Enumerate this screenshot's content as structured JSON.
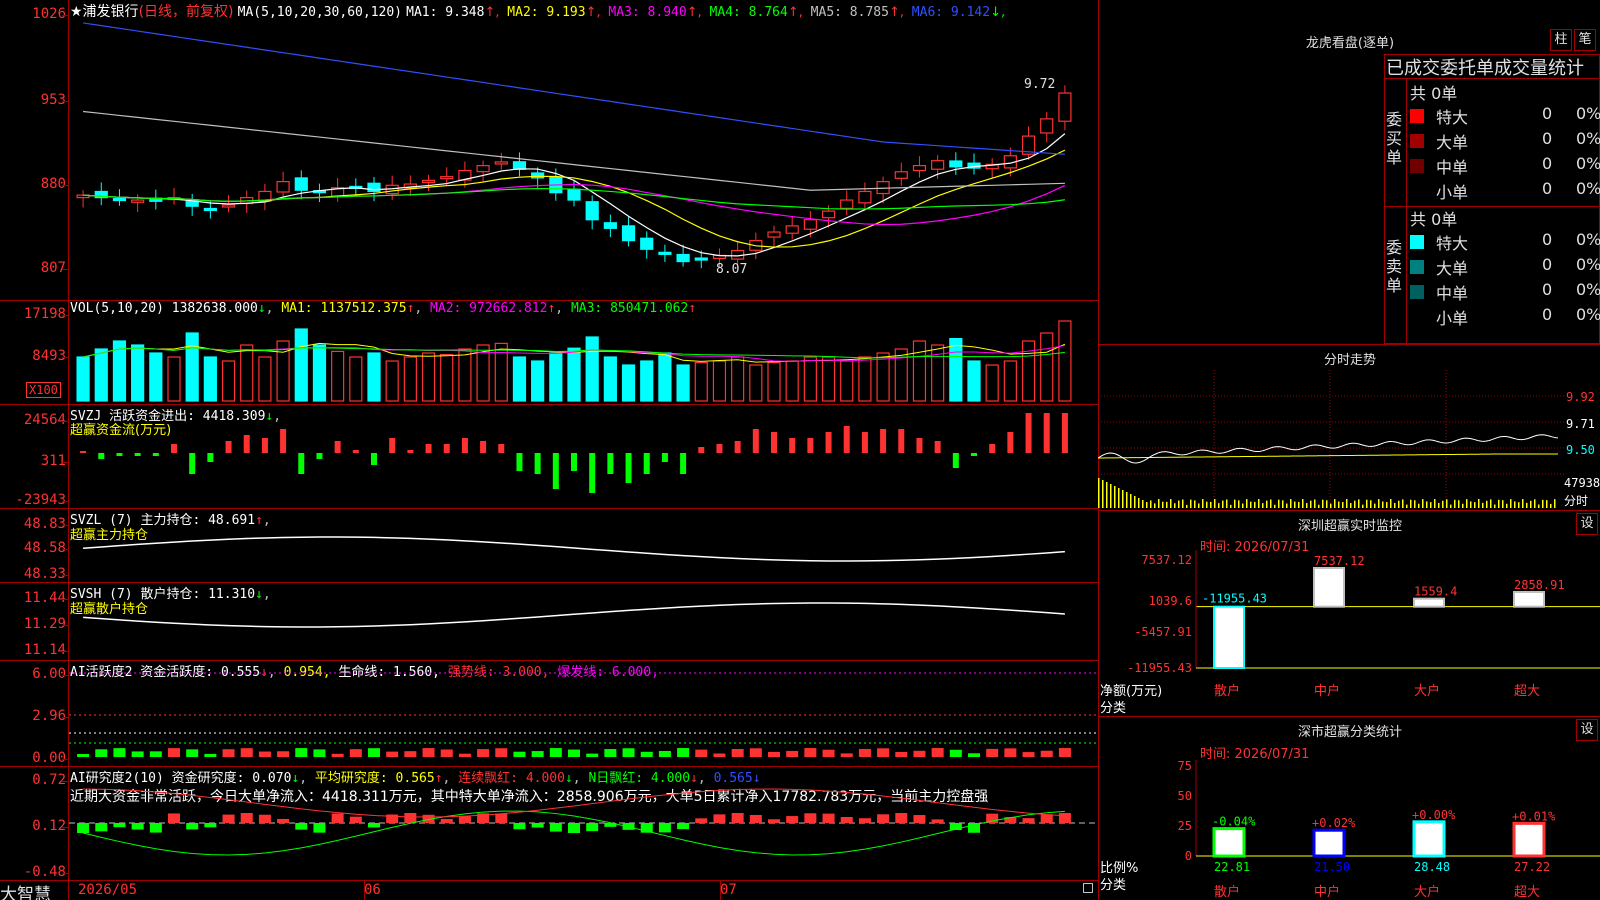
{
  "main": {
    "title": "★浦发银行",
    "period": "(日线，前复权)",
    "ma_header": "MA(5,10,20,30,60,120)",
    "ma": [
      {
        "label": "MA1:",
        "value": "9.348",
        "color": "#ffffff"
      },
      {
        "label": "MA2:",
        "value": "9.193",
        "color": "#ffff00"
      },
      {
        "label": "MA3:",
        "value": "8.940",
        "color": "#ff00ff"
      },
      {
        "label": "MA4:",
        "value": "8.764",
        "color": "#00ff00"
      },
      {
        "label": "MA5:",
        "value": "8.785",
        "color": "#c0c0c0"
      },
      {
        "label": "MA6:",
        "value": "9.142",
        "color": "#3050ff"
      }
    ],
    "y_ticks": [
      "1026",
      "953",
      "880",
      "807"
    ],
    "high_label": "9.72",
    "low_label": "8.07"
  },
  "vol": {
    "header": "VOL(5,10,20)",
    "value": "1382638.000",
    "ma1": "MA1: 1137512.375",
    "ma2": "MA2: 972662.812",
    "ma3": "MA3: 850471.062",
    "y_ticks": [
      "17198",
      "8493"
    ],
    "unit": "X100"
  },
  "svzj": {
    "header": "SVZJ  活跃资金进出: 4418.309",
    "sub": "超赢资金流(万元)",
    "y_ticks": [
      "24564",
      "311",
      "-23943"
    ]
  },
  "svzl": {
    "header": "SVZL (7) 主力持仓: 48.691",
    "sub": "超赢主力持仓",
    "y_ticks": [
      "48.83",
      "48.58",
      "48.33"
    ]
  },
  "svsh": {
    "header": "SVSH (7) 散户持仓: 11.310",
    "sub": "超赢散户持仓",
    "y_ticks": [
      "11.44",
      "11.29",
      "11.14"
    ]
  },
  "ai1": {
    "header": "AI活跃度2 资金活跃度: 0.555",
    "v2": "0.954,",
    "life": "生命线: 1.560,",
    "strong": "强势线: 3.000,",
    "burst": "爆发线: 6.000,",
    "y_ticks": [
      "6.00",
      "2.96",
      "0.00"
    ]
  },
  "ai2": {
    "header": "AI研究度2(10) 资金研究度: 0.070",
    "avg": "平均研究度: 0.565",
    "cont": "连续飘红: 4.000",
    "nday": "N日飘红: 4.000",
    "v5": "0.565",
    "desc": "近期大资金非常活跃，今日大单净流入：4418.311万元，其中特大单净流入：2858.906万元，大单5日累计净入17782.783万元，当前主力控盘强",
    "y_ticks": [
      "0.72",
      "0.12",
      "-0.48"
    ]
  },
  "bottom": {
    "brand": "大智慧",
    "dates": [
      "2026/05",
      "06",
      "07"
    ]
  },
  "right": {
    "dragon_title": "龙虎看盘(逐单)",
    "btn_bar": "柱",
    "btn_pen": "笔",
    "stat_title": "已成交委托单成交量统计",
    "buy_label": "委买单",
    "sell_label": "委卖单",
    "buy_total": "共 0单",
    "sell_total": "共 0单",
    "buy_rows": [
      {
        "name": "特大",
        "count": "0",
        "pct": "0%",
        "color": "#ff0000"
      },
      {
        "name": "大单",
        "count": "0",
        "pct": "0%",
        "color": "#a00000"
      },
      {
        "name": "中单",
        "count": "0",
        "pct": "0%",
        "color": "#700000"
      },
      {
        "name": "小单",
        "count": "0",
        "pct": "0%",
        "color": ""
      }
    ],
    "sell_rows": [
      {
        "name": "特大",
        "count": "0",
        "pct": "0%",
        "color": "#00ffff"
      },
      {
        "name": "大单",
        "count": "0",
        "pct": "0%",
        "color": "#008080"
      },
      {
        "name": "中单",
        "count": "0",
        "pct": "0%",
        "color": "#006060"
      },
      {
        "name": "小单",
        "count": "0",
        "pct": "0%",
        "color": ""
      }
    ],
    "intraday_title": "分时走势",
    "intraday_prices": [
      "9.92",
      "9.71",
      "9.50"
    ],
    "intraday_vol": "47938",
    "intraday_unit": "分时",
    "monitor_title": "深圳超赢实时监控",
    "monitor_time": "时间: 2026/07/31",
    "settings": "设",
    "monitor_y": [
      "7537.12",
      "1039.6",
      "-5457.91",
      "-11955.43"
    ],
    "monitor_y_label": "净额(万元)",
    "monitor_x_label": "分类",
    "monitor_cats": [
      "散户",
      "中户",
      "大户",
      "超大"
    ],
    "monitor_values": [
      -11955.43,
      7537.12,
      1559.4,
      2858.91
    ],
    "monitor_value_labels": [
      "-11955.43",
      "7537.12",
      "1559.4",
      "2858.91"
    ],
    "class_title": "深市超赢分类统计",
    "class_time": "时间: 2026/07/31",
    "class_y": [
      "75",
      "50",
      "25",
      "0"
    ],
    "class_y_label": "比例%",
    "class_x_label": "分类",
    "class_cats": [
      "散户",
      "中户",
      "大户",
      "超大"
    ],
    "class_values": [
      22.81,
      21.5,
      28.48,
      27.22
    ],
    "class_value_labels": [
      "22.81",
      "21.50",
      "28.48",
      "27.22"
    ],
    "class_changes": [
      "-0.04%",
      "+0.02%",
      "+0.00%",
      "+0.01%"
    ]
  },
  "colors": {
    "up": "#ff3232",
    "down": "#00ffff",
    "grid": "#a00000",
    "ma1": "#ffffff",
    "ma2": "#ffff00",
    "ma3": "#ff00ff",
    "ma4": "#00ff00",
    "ma5": "#c0c0c0",
    "ma6": "#3050ff"
  }
}
